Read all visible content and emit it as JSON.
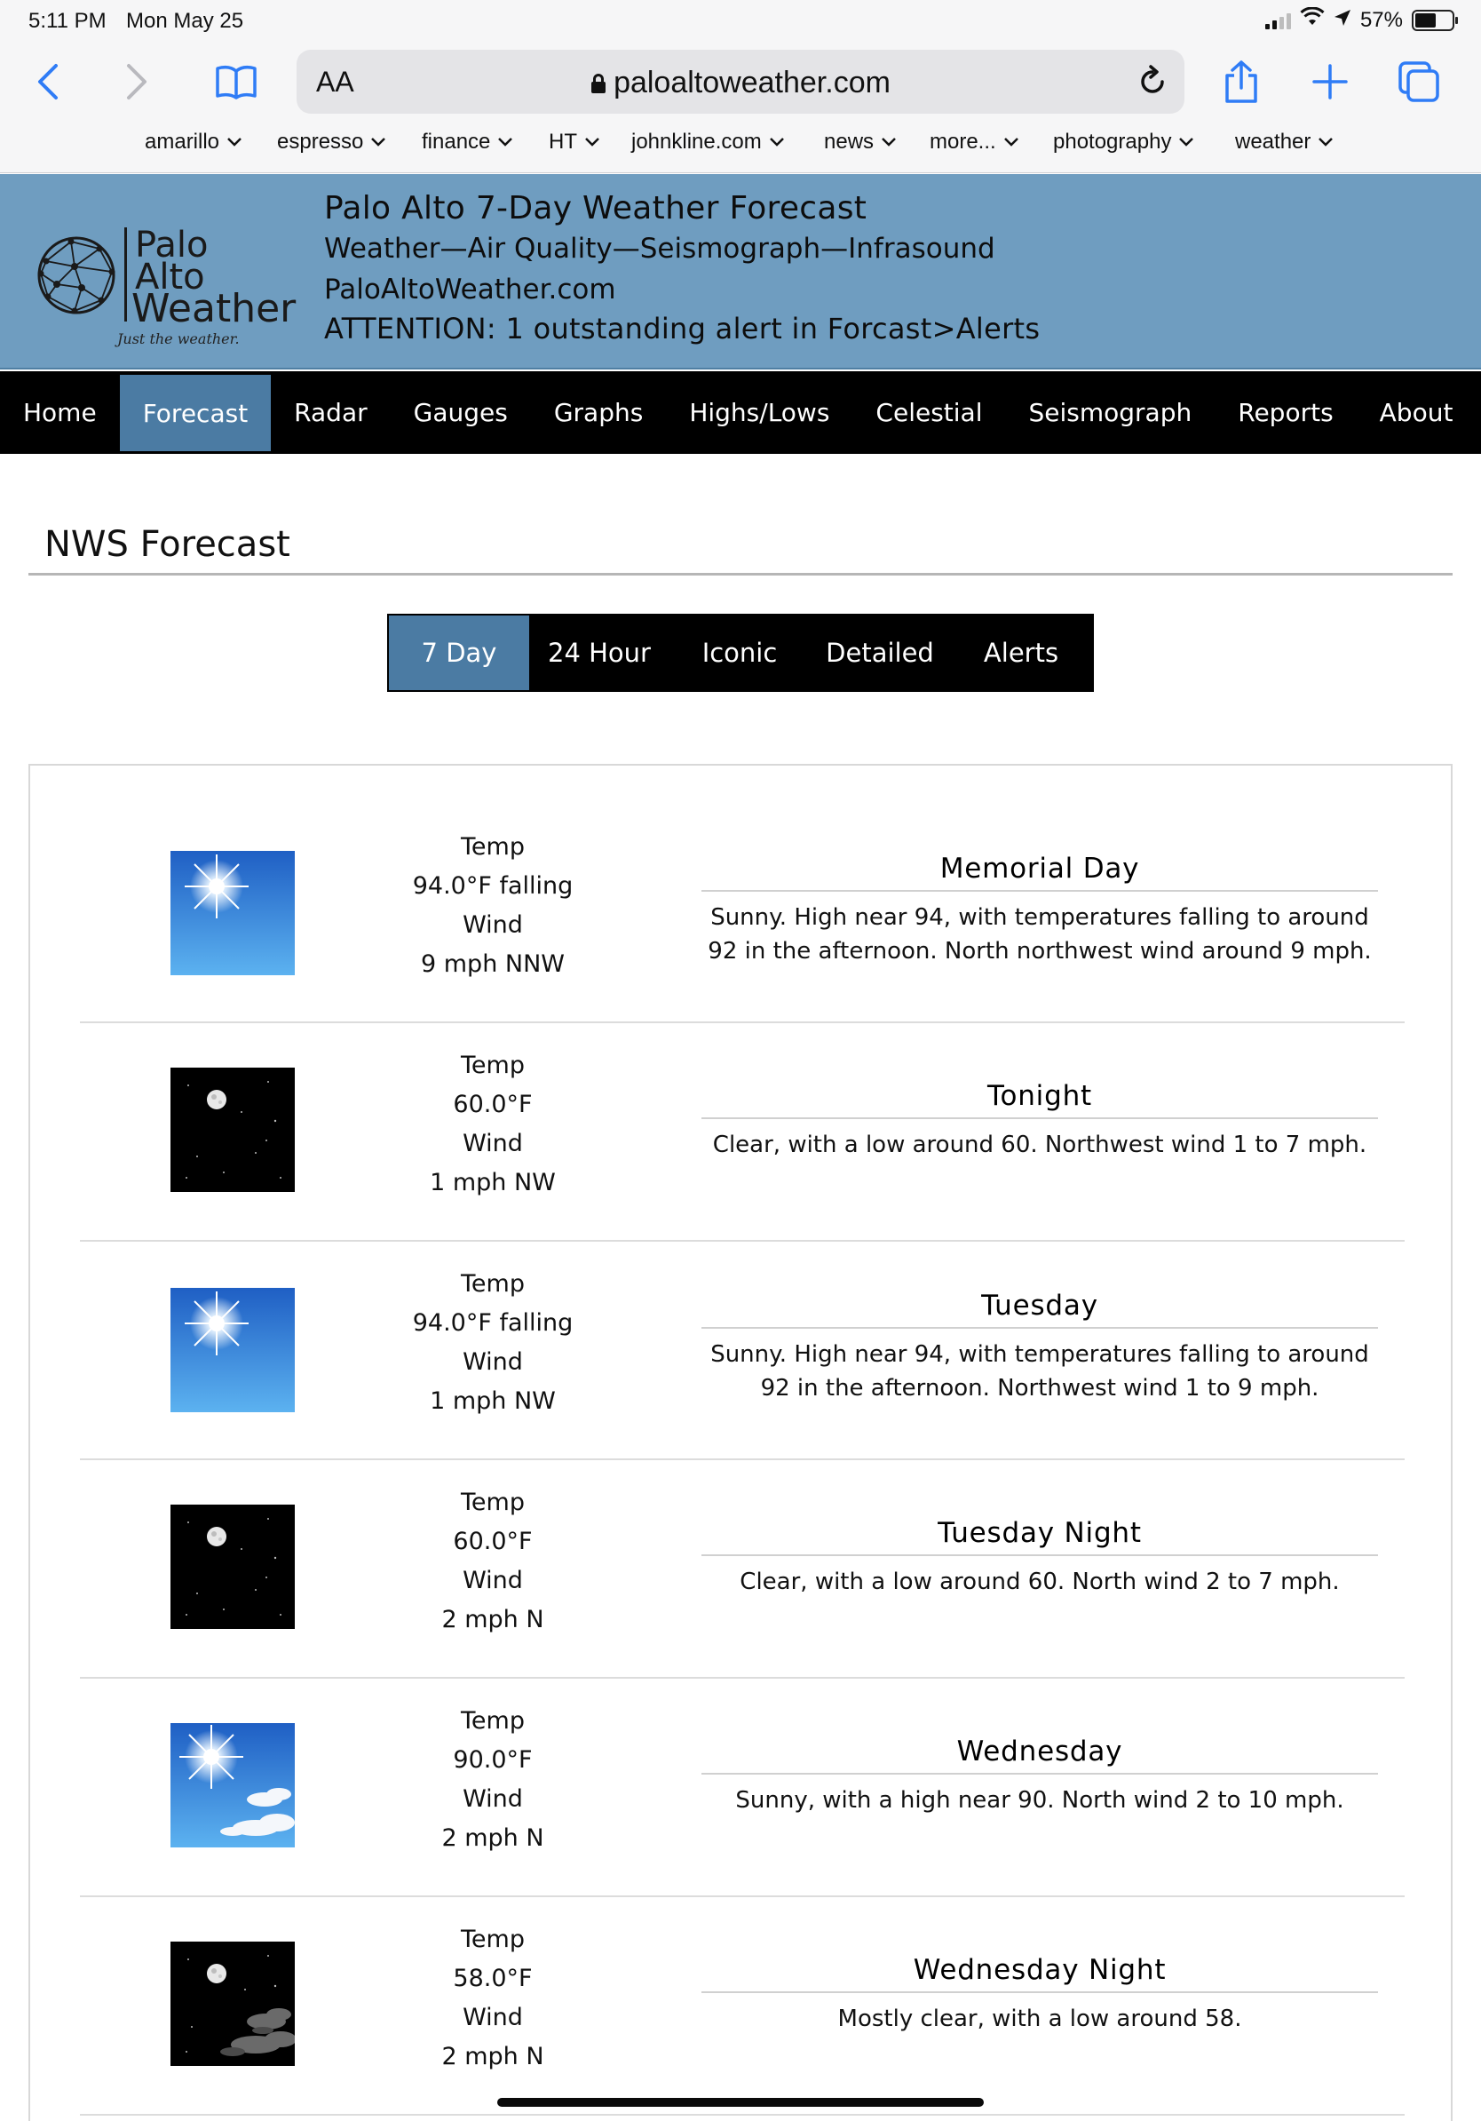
{
  "status_bar": {
    "time": "5:11 PM",
    "date": "Mon May 25",
    "battery": "57%",
    "battery_level": 0.57
  },
  "browser": {
    "text_size_label": "AA",
    "url": "paloaltoweather.com",
    "favorites": [
      {
        "label": "amarillo"
      },
      {
        "label": "espresso"
      },
      {
        "label": "finance"
      },
      {
        "label": "HT"
      },
      {
        "label": "johnkline.com"
      },
      {
        "label": "news"
      },
      {
        "label": "more..."
      },
      {
        "label": "photography"
      },
      {
        "label": "weather"
      }
    ]
  },
  "site": {
    "logo_lines": [
      "Palo",
      "Alto",
      "Weather"
    ],
    "logo_tagline": "Just the weather.",
    "title": "Palo Alto 7-Day Weather Forecast",
    "subtitle": "Weather—Air Quality—Seismograph—Infrasound",
    "domain": "PaloAltoWeather.com",
    "attention": "ATTENTION: 1 outstanding alert in Forcast>Alerts"
  },
  "nav": {
    "items": [
      {
        "label": "Home"
      },
      {
        "label": "Forecast"
      },
      {
        "label": "Radar"
      },
      {
        "label": "Gauges"
      },
      {
        "label": "Graphs"
      },
      {
        "label": "Highs/Lows"
      },
      {
        "label": "Celestial"
      },
      {
        "label": "Seismograph"
      },
      {
        "label": "Reports"
      },
      {
        "label": "About"
      }
    ],
    "active": "Forecast"
  },
  "section_title": "NWS Forecast",
  "tabs": {
    "items": [
      {
        "label": "7 Day"
      },
      {
        "label": "24 Hour"
      },
      {
        "label": "Iconic"
      },
      {
        "label": "Detailed"
      },
      {
        "label": "Alerts"
      }
    ],
    "active": "7 Day"
  },
  "forecast": [
    {
      "icon": "sunny-icon",
      "temp_label": "Temp",
      "temp": "94.0°F falling",
      "wind_label": "Wind",
      "wind": "9 mph NNW",
      "period": "Memorial Day",
      "text": "Sunny. High near 94, with temperatures falling to around 92 in the afternoon. North northwest wind around 9 mph."
    },
    {
      "icon": "clear-night-icon",
      "temp_label": "Temp",
      "temp": "60.0°F",
      "wind_label": "Wind",
      "wind": "1 mph NW",
      "period": "Tonight",
      "text": "Clear, with a low around 60. Northwest wind 1 to 7 mph."
    },
    {
      "icon": "sunny-icon",
      "temp_label": "Temp",
      "temp": "94.0°F falling",
      "wind_label": "Wind",
      "wind": "1 mph NW",
      "period": "Tuesday",
      "text": "Sunny. High near 94, with temperatures falling to around 92 in the afternoon. Northwest wind 1 to 9 mph."
    },
    {
      "icon": "clear-night-icon",
      "temp_label": "Temp",
      "temp": "60.0°F",
      "wind_label": "Wind",
      "wind": "2 mph N",
      "period": "Tuesday Night",
      "text": "Clear, with a low around 60. North wind 2 to 7 mph."
    },
    {
      "icon": "sunny-clouds-icon",
      "temp_label": "Temp",
      "temp": "90.0°F",
      "wind_label": "Wind",
      "wind": "2 mph N",
      "period": "Wednesday",
      "text": "Sunny, with a high near 90. North wind 2 to 10 mph."
    },
    {
      "icon": "mostly-clear-night-icon",
      "temp_label": "Temp",
      "temp": "58.0°F",
      "wind_label": "Wind",
      "wind": "2 mph N",
      "period": "Wednesday Night",
      "text": "Mostly clear, with a low around 58."
    }
  ]
}
